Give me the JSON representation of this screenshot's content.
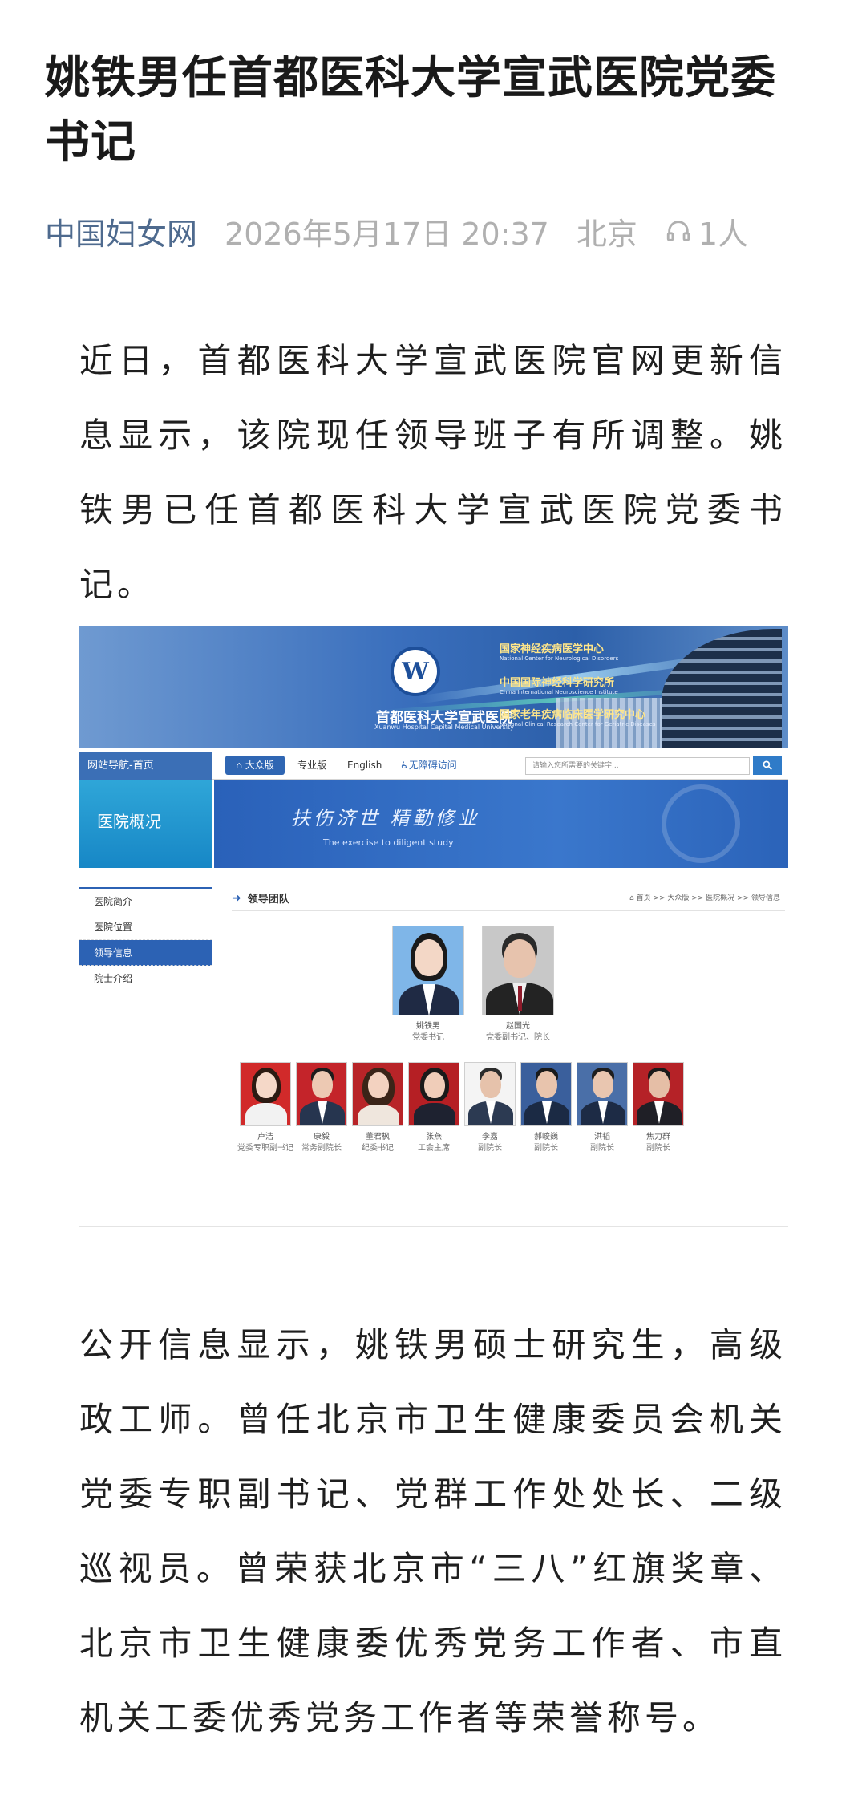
{
  "article": {
    "title": "姚铁男任首都医科大学宣武医院党委书记",
    "source": "中国妇女网",
    "datetime": "2026年5月17日 20:37",
    "location": "北京",
    "listeners": "1人",
    "paragraph1": "近日，首都医科大学宣武医院官网更新信息显示，该院现任领导班子有所调整。姚铁男已任首都医科大学宣武医院党委书记。",
    "paragraph2": "公开信息显示，姚铁男硕士研究生，高级政工师。曾任北京市卫生健康委员会机关党委专职副书记、党群工作处处长、二级巡视员。曾荣获北京市“三八”红旗奖章、北京市卫生健康委优秀党务工作者、市直机关工委优秀党务工作者等荣誉称号。"
  },
  "embedded_site": {
    "banner": {
      "hospital_name_cn": "首都医科大学宣武医院",
      "hospital_name_en": "Xuanwu Hospital Capital Medical University",
      "logo_text": "W",
      "items": [
        {
          "cn": "国家神经疾病医学中心",
          "en": "National Center for Neurological Disorders"
        },
        {
          "cn": "中国国际神经科学研究所",
          "en": "China International Neuroscience Institute"
        },
        {
          "cn": "国家老年疾病临床医学研究中心",
          "en": "National Clinical Research Center for Geriatric Diseases"
        }
      ]
    },
    "nav": {
      "home": "网站导航-首页",
      "public": "大众版",
      "pro": "专业版",
      "english": "English",
      "accessibility": "无障碍访问",
      "search_placeholder": "请输入您所需要的关键字..."
    },
    "sidebar": {
      "heading": "医院概况",
      "items": [
        {
          "label": "医院简介",
          "active": false
        },
        {
          "label": "医院位置",
          "active": false
        },
        {
          "label": "领导信息",
          "active": true
        },
        {
          "label": "院士介绍",
          "active": false
        }
      ]
    },
    "slogan": {
      "cn": "扶伤济世  精勤修业",
      "en": "The exercise to diligent study"
    },
    "section": {
      "title": "领导团队",
      "breadcrumb": "首页 >> 大众版 >> 医院概况 >> 领导信息"
    },
    "leaders_top": [
      {
        "name": "姚铁男",
        "role": "党委书记"
      },
      {
        "name": "赵国光",
        "role": "党委副书记、院长"
      }
    ],
    "leaders_row": [
      {
        "name": "卢洁",
        "role": "党委专职副书记"
      },
      {
        "name": "康毅",
        "role": "常务副院长"
      },
      {
        "name": "董君枫",
        "role": "纪委书记"
      },
      {
        "name": "张燕",
        "role": "工会主席"
      },
      {
        "name": "李嘉",
        "role": "副院长"
      },
      {
        "name": "郝峻巍",
        "role": "副院长"
      },
      {
        "name": "洪韬",
        "role": "副院长"
      },
      {
        "name": "焦力群",
        "role": "副院长"
      }
    ]
  },
  "colors": {
    "source_link": "#4e6a8e",
    "meta_gray": "#b0b0b0",
    "site_blue": "#2c62b4"
  }
}
